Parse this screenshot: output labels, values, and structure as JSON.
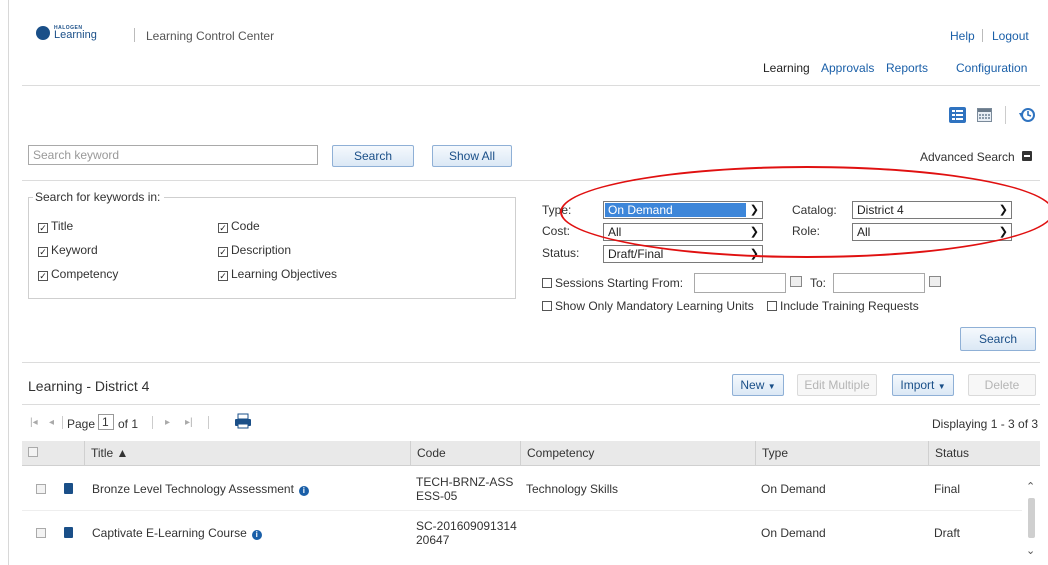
{
  "header": {
    "logo_small": "HALOGEN",
    "logo_big": "Learning",
    "app_title": "Learning Control Center",
    "top_links": [
      "Help",
      "Logout"
    ],
    "nav": [
      "Learning",
      "Approvals",
      "Reports",
      "Configuration"
    ]
  },
  "search": {
    "placeholder": "Search keyword",
    "search_label": "Search",
    "show_all_label": "Show All",
    "advanced_label": "Advanced Search"
  },
  "keywords": {
    "legend": "Search for keywords in:",
    "col1": [
      "Title",
      "Keyword",
      "Competency"
    ],
    "col2": [
      "Code",
      "Description",
      "Learning Objectives"
    ]
  },
  "filters": {
    "type_label": "Type:",
    "type_value": "On Demand",
    "cost_label": "Cost:",
    "cost_value": "All",
    "status_label": "Status:",
    "status_value": "Draft/Final",
    "catalog_label": "Catalog:",
    "catalog_value": "District 4",
    "role_label": "Role:",
    "role_value": "All",
    "sessions_label": "Sessions Starting From:",
    "to_label": "To:",
    "mandatory_label": "Show Only Mandatory Learning Units",
    "training_label": "Include Training Requests",
    "search_label": "Search"
  },
  "list": {
    "title": "Learning - District 4",
    "new_label": "New",
    "edit_multiple_label": "Edit Multiple",
    "import_label": "Import",
    "delete_label": "Delete",
    "page_label": "Page",
    "page_value": "1",
    "of_label": "of 1",
    "displaying": "Displaying 1 - 3 of 3",
    "columns": [
      "Title ▲",
      "Code",
      "Competency",
      "Type",
      "Status"
    ],
    "rows": [
      {
        "title": "Bronze Level Technology Assessment",
        "code_l1": "TECH-BRNZ-ASS",
        "code_l2": "ESS-05",
        "competency": "Technology Skills",
        "type": "On Demand",
        "status": "Final"
      },
      {
        "title": "Captivate E-Learning Course",
        "code_l1": "SC-201609091314",
        "code_l2": "20647",
        "competency": "",
        "type": "On Demand",
        "status": "Draft"
      }
    ]
  },
  "colors": {
    "link": "#1a5fa8",
    "accent": "#1a4f88",
    "highlight": "#3d86d9",
    "annotation": "#e01010"
  }
}
